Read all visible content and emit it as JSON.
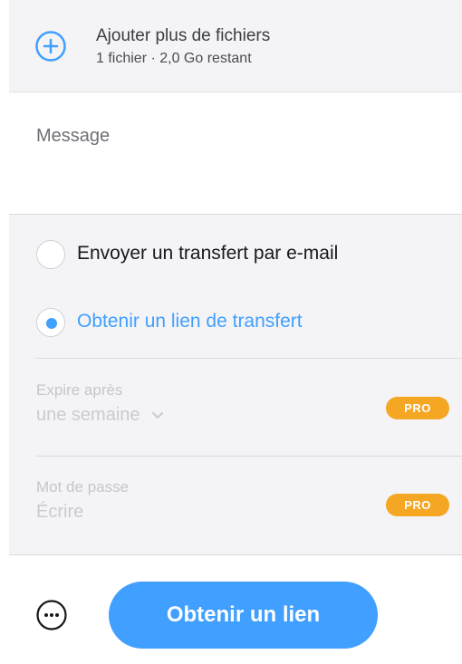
{
  "upload": {
    "title": "Ajouter plus de fichiers",
    "subtitle": "1 fichier · 2,0 Go restant"
  },
  "message": {
    "placeholder": "Message"
  },
  "transfer_options": [
    {
      "label": "Envoyer un transfert par e-mail",
      "selected": false
    },
    {
      "label": "Obtenir un lien de transfert",
      "selected": true
    }
  ],
  "expiry": {
    "label": "Expire après",
    "value": "une semaine",
    "badge": "PRO"
  },
  "password": {
    "label": "Mot de passe",
    "placeholder": "Écrire",
    "badge": "PRO"
  },
  "footer": {
    "cta_label": "Obtenir un lien"
  },
  "colors": {
    "accent": "#409fff",
    "pro_badge": "#f5a623",
    "panel_bg": "#f4f4f6"
  },
  "icons": {
    "add": "plus-circle-icon",
    "more": "more-options-icon",
    "dropdown": "chevron-down-icon"
  }
}
